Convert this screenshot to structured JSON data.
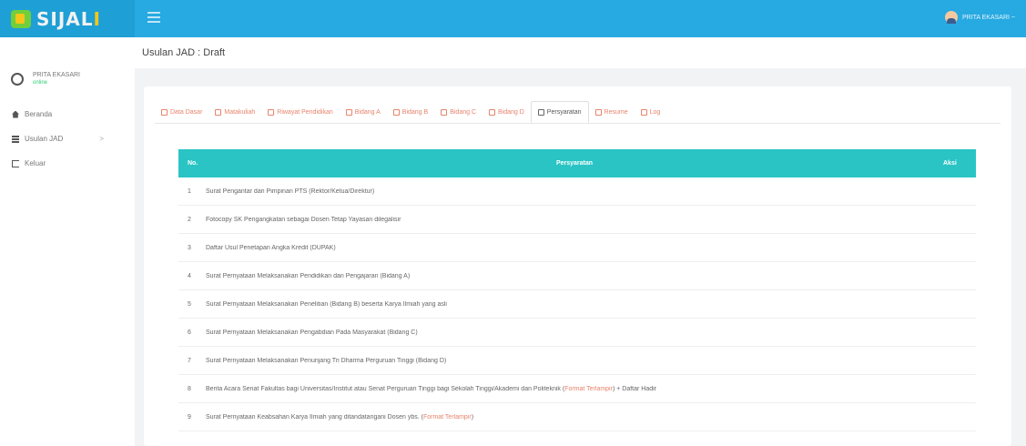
{
  "app": {
    "brand_main": "SIJAL",
    "brand_accent": "I"
  },
  "user": {
    "name": "PRITA EKASARI",
    "status": "online",
    "menu_label": "PRITA EKASARI ~"
  },
  "sidebar": {
    "items": [
      {
        "label": "Beranda",
        "icon": "home-icon"
      },
      {
        "label": "Usulan JAD",
        "icon": "list-icon",
        "chevron": ">"
      },
      {
        "label": "Keluar",
        "icon": "logout-icon"
      }
    ]
  },
  "page": {
    "title": "Usulan JAD : Draft"
  },
  "tabs": [
    {
      "label": "Data Dasar",
      "active": false
    },
    {
      "label": "Matakuliah",
      "active": false
    },
    {
      "label": "Riwayat Pendidikan",
      "active": false
    },
    {
      "label": "Bidang A",
      "active": false
    },
    {
      "label": "Bidang B",
      "active": false
    },
    {
      "label": "Bidang C",
      "active": false
    },
    {
      "label": "Bidang D",
      "active": false
    },
    {
      "label": "Persyaratan",
      "active": true
    },
    {
      "label": "Resume",
      "active": false
    },
    {
      "label": "Log",
      "active": false
    }
  ],
  "table": {
    "headers": {
      "no": "No.",
      "requirement": "Persyaratan",
      "action": "Aksi"
    },
    "rows": [
      {
        "no": "1",
        "text": "Surat Pengantar dari Pimpinan PTS (Rektor/Ketua/Direktur)"
      },
      {
        "no": "2",
        "text": "Fotocopy SK Pengangkatan sebagai Dosen Tetap Yayasan dilegalisir"
      },
      {
        "no": "3",
        "text": "Daftar Usul Penetapan Angka Kredit (DUPAK)"
      },
      {
        "no": "4",
        "text": "Surat Pernyataan Melaksanakan Pendidikan dan Pengajaran (Bidang A)"
      },
      {
        "no": "5",
        "text": "Surat Pernyataan Melaksanakan Penelitian (Bidang B) beserta Karya Ilmiah yang asli"
      },
      {
        "no": "6",
        "text": "Surat Pernyataan Melaksanakan Pengabdian Pada Masyarakat (Bidang C)"
      },
      {
        "no": "7",
        "text": "Surat Pernyataan Melaksanakan Penunjang Tri Dharma Perguruan Tinggi (Bidang D)"
      },
      {
        "no": "8",
        "text": "Berita Acara Senat Fakultas bagi Universitas/Institut atau Senat Perguruan Tinggi bagi Sekolah Tinggi/Akademi dan Politeknik (",
        "link": "Format Terlampir",
        "suffix": ") + Daftar Hadir"
      },
      {
        "no": "9",
        "text": "Surat Pernyataan Keabsahan Karya Ilmiah yang ditandatangani Dosen ybs. (",
        "link": "Format Terlampir",
        "suffix": ")"
      }
    ]
  }
}
